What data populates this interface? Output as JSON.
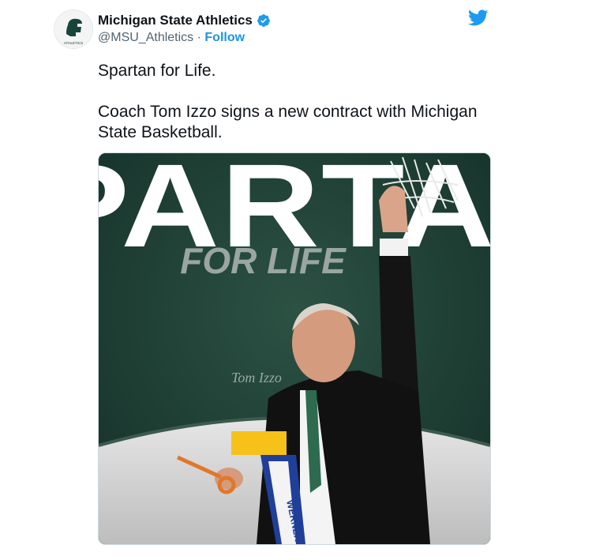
{
  "author": {
    "display_name": "Michigan State Athletics",
    "handle": "@MSU_Athletics",
    "separator": "·",
    "follow_label": "Follow",
    "avatar_logo_text": "ATHLETICS",
    "verified_color": "#1d9bf0"
  },
  "tweet": {
    "text": "Spartan for Life.\n\nCoach Tom Izzo signs a new contract with Michigan State Basketball."
  },
  "media": {
    "headline": "SPARTAN",
    "subheadline": "FOR LIFE",
    "signature": "Tom Izzo",
    "ladder_brand": "WERNER",
    "background_color": "#1e3d31",
    "floor_color": "#dcdcdc"
  },
  "colors": {
    "brand_green": "#18453b",
    "twitter_blue": "#1d9bf0",
    "link_blue": "#1b95e0"
  }
}
